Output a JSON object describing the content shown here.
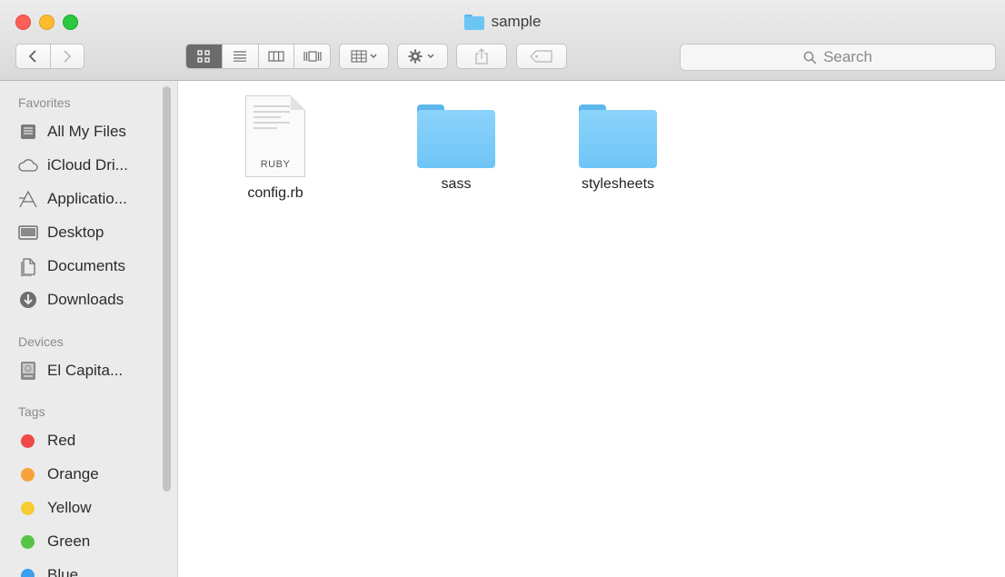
{
  "window": {
    "title": "sample"
  },
  "colors": {
    "folder": "#6ec5f6",
    "sidebar_bg": "#ebebeb"
  },
  "toolbar": {
    "back_icon": "chevron-left-icon",
    "forward_icon": "chevron-right-icon",
    "view_modes": [
      "icon-view",
      "list-view",
      "column-view",
      "cover-flow-view"
    ],
    "search_placeholder": "Search"
  },
  "sidebar": {
    "favorites_label": "Favorites",
    "favorites": [
      {
        "label": "All My Files",
        "icon": "all-files-icon"
      },
      {
        "label": "iCloud Dri...",
        "icon": "cloud-icon"
      },
      {
        "label": "Applicatio...",
        "icon": "applications-icon"
      },
      {
        "label": "Desktop",
        "icon": "desktop-icon"
      },
      {
        "label": "Documents",
        "icon": "documents-icon"
      },
      {
        "label": "Downloads",
        "icon": "downloads-icon"
      }
    ],
    "devices_label": "Devices",
    "devices": [
      {
        "label": "El Capita...",
        "icon": "disk-icon"
      }
    ],
    "tags_label": "Tags",
    "tags": [
      {
        "label": "Red",
        "color": "#f0494a"
      },
      {
        "label": "Orange",
        "color": "#f5a33a"
      },
      {
        "label": "Yellow",
        "color": "#f7cc32"
      },
      {
        "label": "Green",
        "color": "#55c447"
      },
      {
        "label": "Blue",
        "color": "#3b9ef0"
      }
    ]
  },
  "files": [
    {
      "name": "config.rb",
      "kind": "document",
      "ext": "RUBY"
    },
    {
      "name": "sass",
      "kind": "folder"
    },
    {
      "name": "stylesheets",
      "kind": "folder"
    }
  ]
}
